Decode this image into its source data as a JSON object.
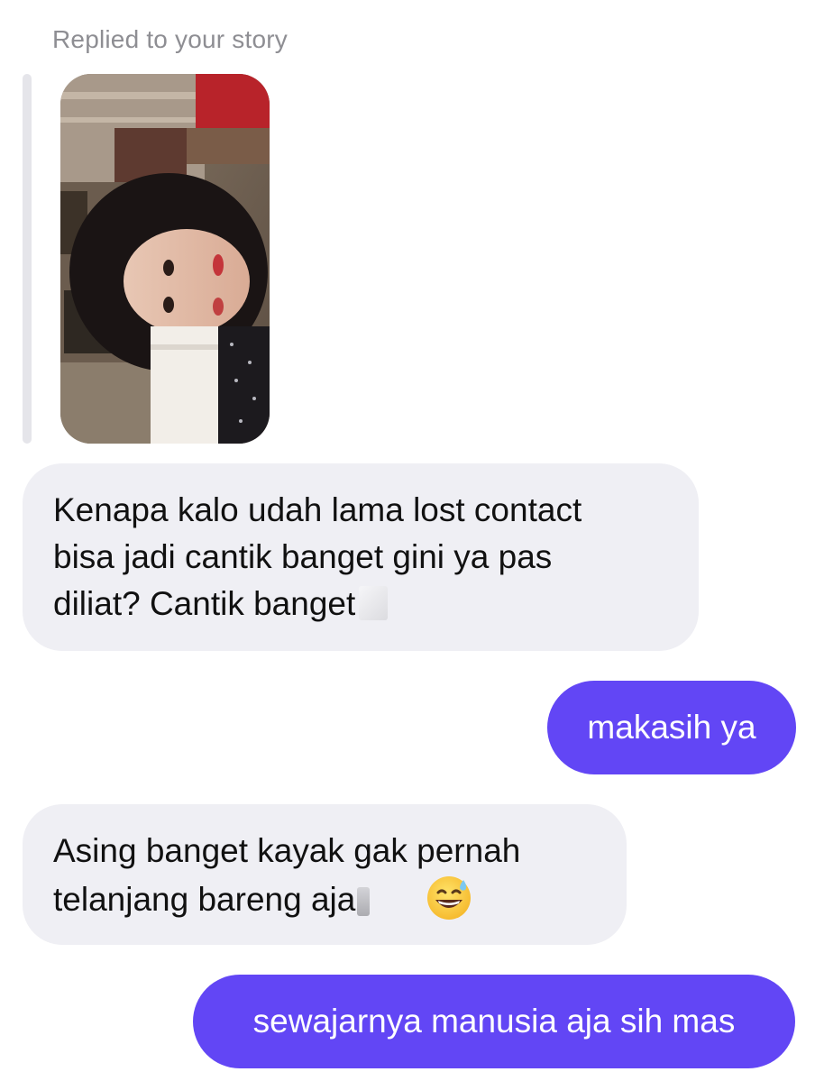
{
  "reply_header": {
    "label": "Replied to your story"
  },
  "story": {
    "thumbnail_icon": "story-photo-thumbnail"
  },
  "messages": [
    {
      "direction": "incoming",
      "lines": [
        "Kenapa kalo udah lama lost contact",
        "bisa jadi cantik banget gini ya pas",
        "diliat? Cantik banget"
      ]
    },
    {
      "direction": "outgoing",
      "text": "makasih ya"
    },
    {
      "direction": "incoming",
      "lines": [
        "Asing banget kayak gak pernah",
        "telanjang bareng aja"
      ],
      "emoji_icon": "grinning-sweat-emoji-icon"
    },
    {
      "direction": "outgoing",
      "text": "sewajarnya manusia aja sih mas"
    }
  ],
  "colors": {
    "incoming_bubble": "#efeff4",
    "outgoing_bubble": "#6246f5",
    "meta_text": "#8e8e93"
  }
}
